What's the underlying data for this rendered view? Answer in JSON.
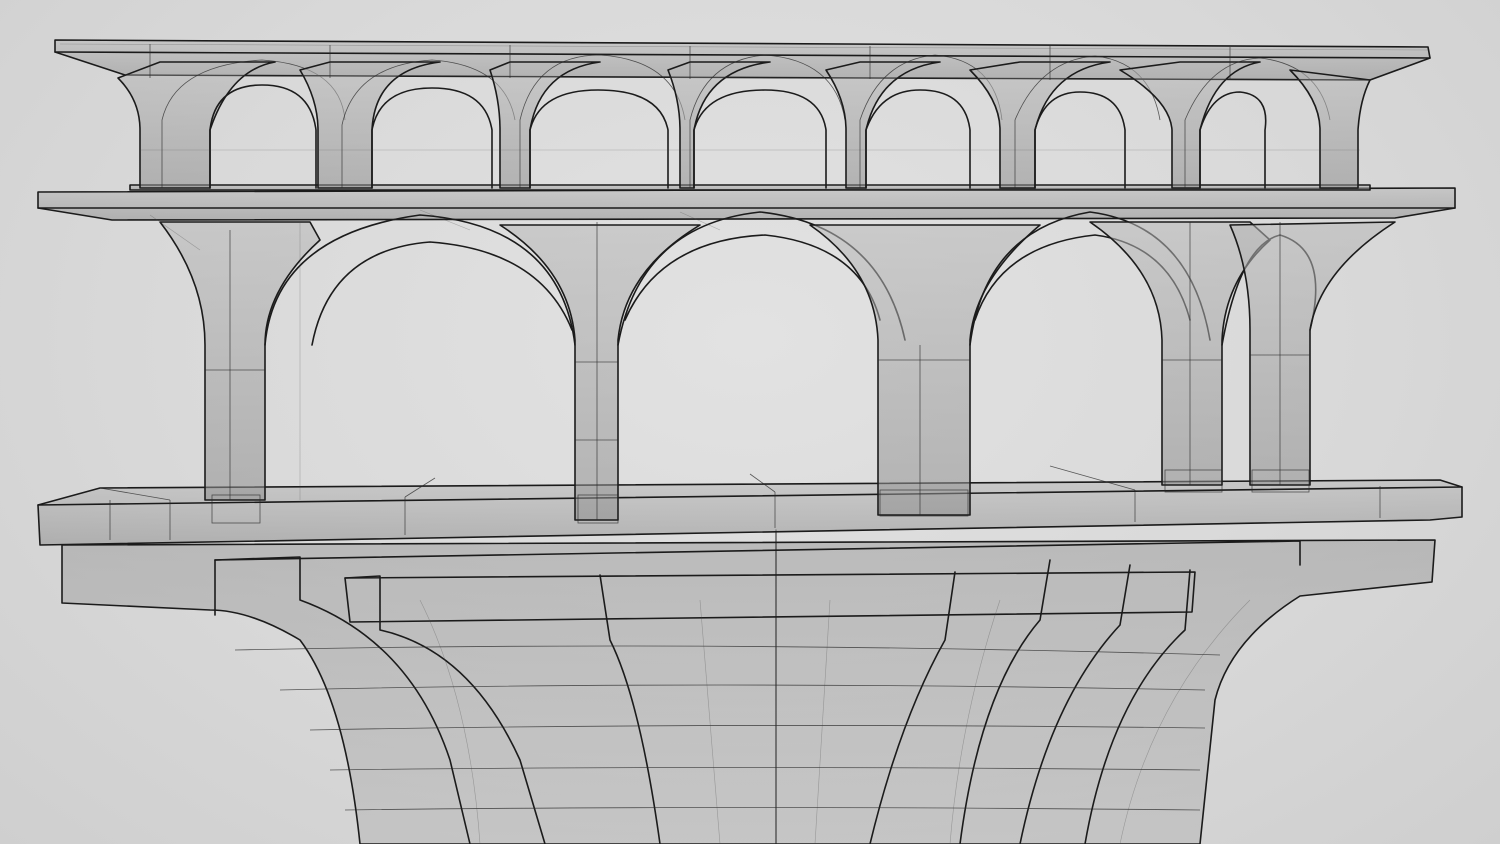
{
  "scene": {
    "subject": "aqueduct-wireframe",
    "render_style": "transparent-shaded-wireframe",
    "colors": {
      "background": "#d9d9d9",
      "surface": "#9e9e9e",
      "surface_light": "#c4c4c4",
      "edge": "#1b1b1b"
    },
    "tiers": {
      "top_arch_count": 7,
      "middle_arch_count": 3,
      "lower_buttresses": 2
    }
  }
}
